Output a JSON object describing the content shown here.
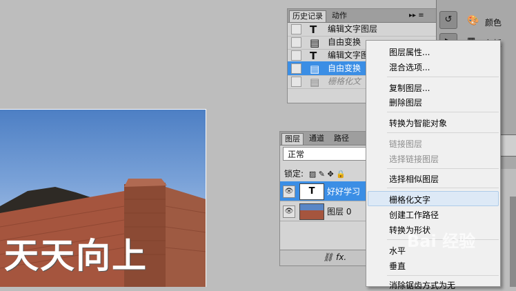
{
  "canvas": {
    "text": "天天向上"
  },
  "history": {
    "tabs": [
      "历史记录",
      "动作"
    ],
    "menu_glyph": "▸▸ ≡",
    "items": [
      {
        "icon": "T",
        "label": "编辑文字图层"
      },
      {
        "icon": "▤",
        "label": "自由变换"
      },
      {
        "icon": "T",
        "label": "编辑文字图"
      },
      {
        "icon": "▤",
        "label": "自由变换"
      },
      {
        "icon": "▤",
        "label": "栅格化文"
      }
    ]
  },
  "dock": {
    "color_label": "颜色",
    "swatch_label": "色板"
  },
  "layers": {
    "tabs": [
      "图层",
      "通道",
      "路径"
    ],
    "blend_mode": "正常",
    "lock_label": "锁定:",
    "lock_icons": "▨ ✎ ✥ 🔒",
    "items": [
      {
        "thumb": "T",
        "label": "好好学习"
      },
      {
        "thumb": "",
        "label": "图层 0"
      }
    ],
    "footer_icons": "⛓ fx."
  },
  "context_menu": {
    "items": [
      {
        "label": "图层属性...",
        "disabled": false
      },
      {
        "label": "混合选项...",
        "disabled": false
      },
      {
        "label": "复制图层...",
        "disabled": false
      },
      {
        "label": "删除图层",
        "disabled": false
      },
      {
        "label": "转换为智能对象",
        "disabled": false
      },
      {
        "label": "链接图层",
        "disabled": true
      },
      {
        "label": "选择链接图层",
        "disabled": true
      },
      {
        "label": "选择相似图层",
        "disabled": false
      },
      {
        "label": "栅格化文字",
        "disabled": false
      },
      {
        "label": "创建工作路径",
        "disabled": false
      },
      {
        "label": "转换为形状",
        "disabled": false
      },
      {
        "label": "水平",
        "disabled": false
      },
      {
        "label": "垂直",
        "disabled": false
      },
      {
        "label": "消除锯齿方式为无",
        "disabled": false
      }
    ]
  },
  "watermark": "Bai 经验"
}
